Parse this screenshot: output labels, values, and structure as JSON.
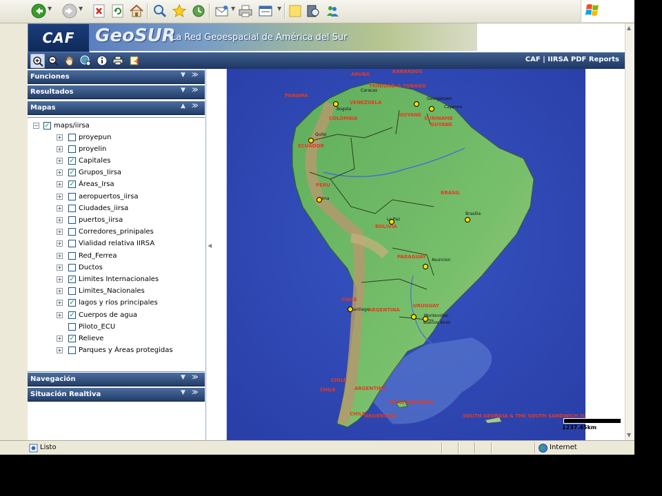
{
  "browser": {
    "toolbar_icons": [
      "back-icon",
      "forward-icon",
      "stop-icon",
      "refresh-icon",
      "home-icon",
      "search-icon",
      "favorites-icon",
      "history-icon",
      "mail-icon",
      "print-icon",
      "edit-icon",
      "notes-icon",
      "research-icon",
      "messenger-icon"
    ]
  },
  "header": {
    "logo": "CAF",
    "brand": "GeoSUR",
    "tagline": "La Red Geoespacial de América del Sur"
  },
  "map_toolbar": {
    "tools": [
      "zoom-in-icon",
      "zoom-out-icon",
      "pan-icon",
      "identify-globe-icon",
      "info-icon",
      "print-map-icon",
      "export-icon"
    ],
    "report_link": "CAF | IIRSA PDF Reports"
  },
  "panel": {
    "sections": {
      "funciones": "Funciones",
      "resultados": "Resultados",
      "mapas": "Mapas",
      "navegacion": "Navegación",
      "situacion": "Situación Realtiva"
    },
    "tree_root": "maps/iirsa",
    "layers": [
      {
        "label": "proyepun",
        "checked": false,
        "expand": true
      },
      {
        "label": "proyelin",
        "checked": false,
        "expand": true
      },
      {
        "label": "Capitales",
        "checked": true,
        "expand": true
      },
      {
        "label": "Grupos_Iirsa",
        "checked": true,
        "expand": true
      },
      {
        "label": "Áreas_Irsa",
        "checked": true,
        "expand": true
      },
      {
        "label": "aeropuertos_iirsa",
        "checked": false,
        "expand": true
      },
      {
        "label": "Ciudades_iirsa",
        "checked": false,
        "expand": true
      },
      {
        "label": "puertos_iirsa",
        "checked": false,
        "expand": true
      },
      {
        "label": "Corredores_prinipales",
        "checked": false,
        "expand": true
      },
      {
        "label": "Vialidad relativa IIRSA",
        "checked": false,
        "expand": true
      },
      {
        "label": "Red_Ferrea",
        "checked": false,
        "expand": true
      },
      {
        "label": "Ductos",
        "checked": false,
        "expand": true
      },
      {
        "label": "Limites Internacionales",
        "checked": true,
        "expand": true
      },
      {
        "label": "Limites_Nacionales",
        "checked": false,
        "expand": true
      },
      {
        "label": "lagos y ríos principales",
        "checked": true,
        "expand": true
      },
      {
        "label": "Cuerpos de agua",
        "checked": true,
        "expand": true
      },
      {
        "label": "Piloto_ECU",
        "checked": false,
        "expand": false
      },
      {
        "label": "Relieve",
        "checked": true,
        "expand": true
      },
      {
        "label": "Parques y Áreas protegidas",
        "checked": false,
        "expand": true
      }
    ]
  },
  "map": {
    "country_labels": [
      "ARUBA",
      "BARBADOS",
      "TRINIDAD & TOBAGO",
      "PANAMA",
      "VENEZUELA",
      "GUYANE",
      "COLOMBIA",
      "SURINAME",
      "GUYANE",
      "ECUADOR",
      "PERU",
      "BRASIL",
      "BOLIVIA",
      "PARAGUAY",
      "CHILE",
      "ARGENTINA",
      "URUGUAY",
      "CHILE",
      "CHILE",
      "ARGENTINA",
      "ISLAS MALVINAS",
      "CHILE",
      "ARGENTINA",
      "SOUTH GEORGIA & THE SOUTH SANDWICH IS"
    ],
    "city_labels": [
      "Caracas",
      "Bogota",
      "Georgetown",
      "Cayenne",
      "Quito",
      "Lima",
      "La Paz",
      "Brasilia",
      "Asuncion",
      "Santiago",
      "Montevideo",
      "Buenos Aires"
    ],
    "scale_text": "1237.45km",
    "colors": {
      "ocean": "#2a45b3",
      "land": "#6fb86a",
      "mountains": "#b39a6e",
      "label": "#e8391f"
    }
  },
  "status": {
    "text": "Listo",
    "zone": "Internet"
  }
}
